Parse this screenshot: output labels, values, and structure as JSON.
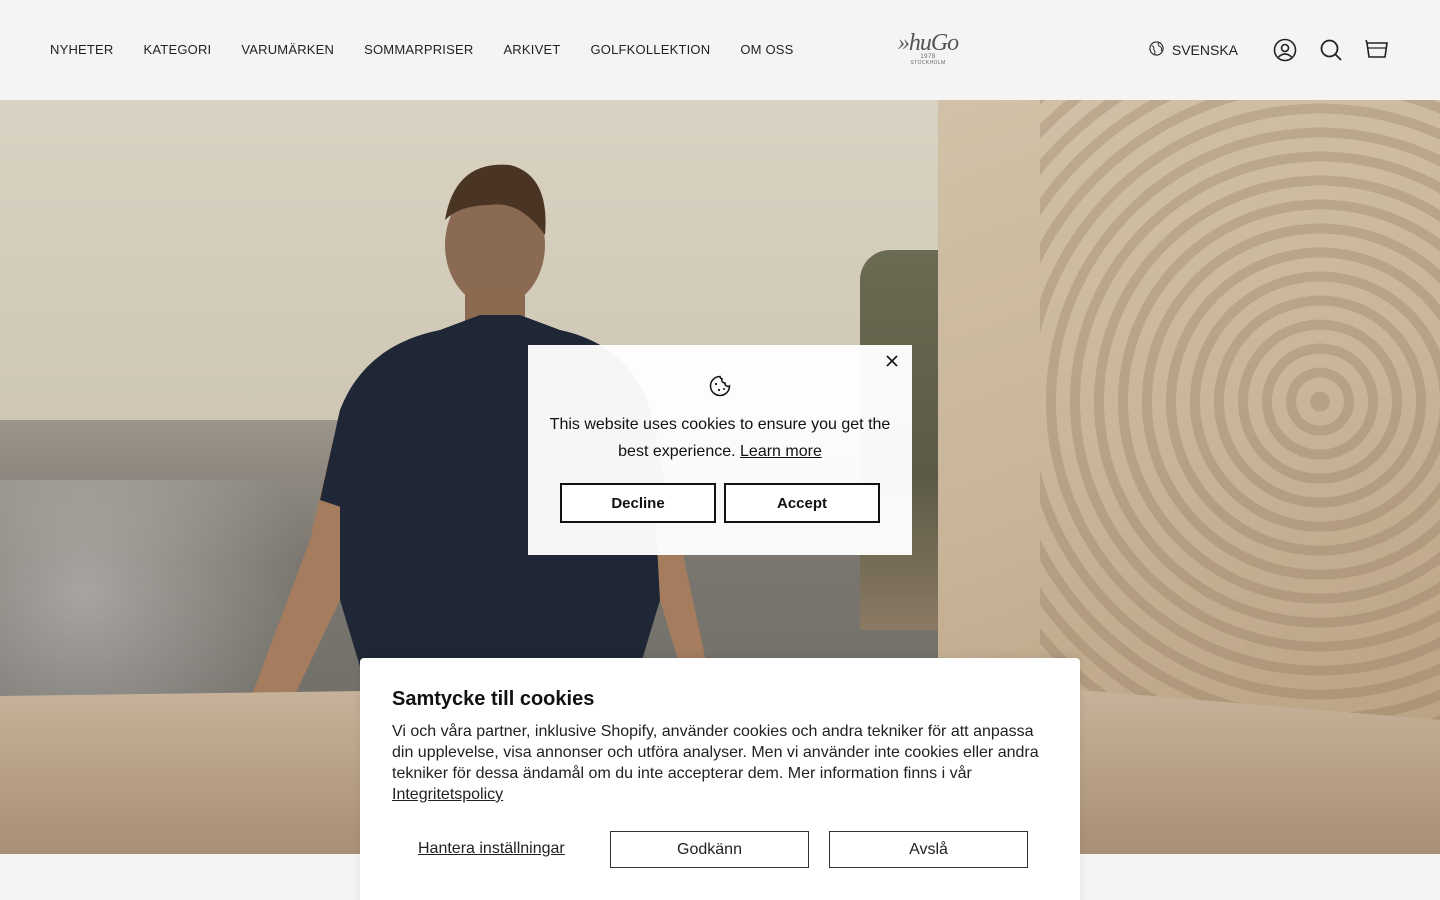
{
  "header": {
    "nav": [
      "NYHETER",
      "KATEGORI",
      "VARUMÄRKEN",
      "SOMMARPRISER",
      "ARKIVET",
      "GOLFKOLLEKTION",
      "OM OSS"
    ],
    "logo": {
      "word": "»huGo",
      "year": "1978",
      "city": "STOCKHOLM"
    },
    "language": "SVENSKA",
    "icons": {
      "language": "globe-icon",
      "account": "account-icon",
      "search": "search-icon",
      "cart": "cart-icon"
    }
  },
  "cookie_popup": {
    "message": "This website uses cookies to ensure you get the best experience.",
    "learn_more": "Learn more",
    "decline": "Decline",
    "accept": "Accept"
  },
  "consent": {
    "title": "Samtycke till cookies",
    "body": "Vi och våra partner, inklusive Shopify, använder cookies och andra tekniker för att anpassa din upplevelse, visa annonser och utföra analyser. Men vi använder inte cookies eller andra tekniker för dessa ändamål om du inte accepterar dem. Mer information finns i vår",
    "policy_link": "Integritetspolicy",
    "manage": "Hantera inställningar",
    "approve": "Godkänn",
    "reject": "Avslå"
  }
}
